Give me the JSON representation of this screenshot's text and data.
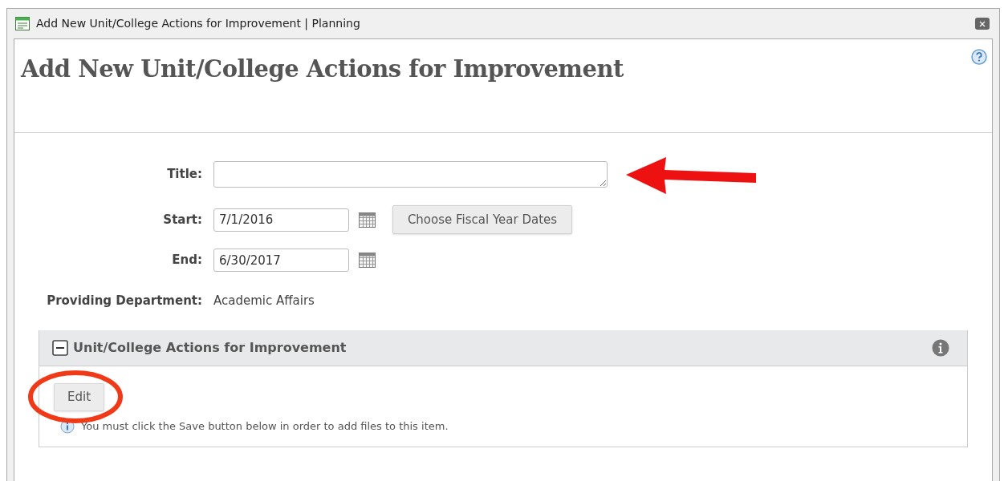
{
  "window": {
    "title": "Add New Unit/College Actions for Improvement | Planning"
  },
  "heading": "Add New Unit/College Actions for Improvement",
  "form": {
    "title": {
      "label": "Title:"
    },
    "start": {
      "label": "Start:",
      "value": "7/1/2016",
      "button": "Choose Fiscal Year Dates"
    },
    "end": {
      "label": "End:",
      "value": "6/30/2017"
    },
    "department": {
      "label": "Providing Department:",
      "value": "Academic Affairs"
    }
  },
  "section": {
    "title": "Unit/College Actions for Improvement",
    "expanded": true,
    "edit_button": "Edit",
    "note": "You must click the Save button below in order to add files to this item."
  }
}
